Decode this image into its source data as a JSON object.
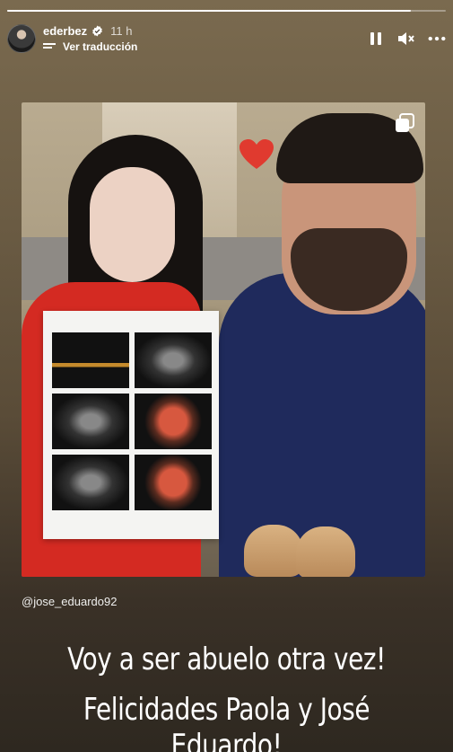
{
  "story": {
    "progress": 0.92,
    "username": "ederbez",
    "verified": true,
    "time_ago": "11 h",
    "translate_label": "Ver traducción",
    "controls": {
      "pause_icon": "pause-icon",
      "mute_icon": "speaker-muted-icon",
      "more_icon": "more-horizontal-icon"
    }
  },
  "photo": {
    "description_icon": "gallery-icon"
  },
  "mention": "@jose_eduardo92",
  "caption": {
    "line1": "Voy a ser abuelo otra vez!",
    "line2": "Felicidades Paola y José Eduardo!"
  },
  "colors": {
    "accent_blue": "#3897f0",
    "text": "#ffffff"
  }
}
